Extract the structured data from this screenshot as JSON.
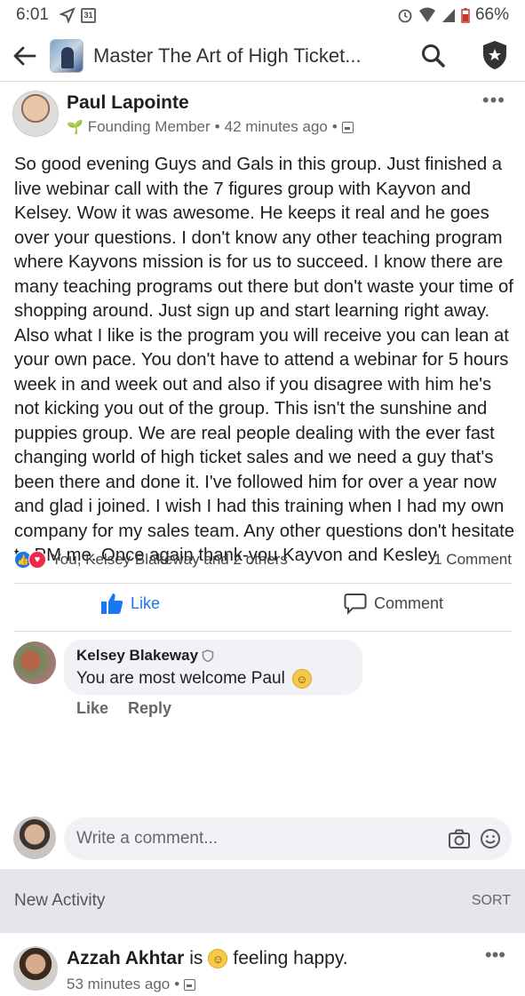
{
  "status_bar": {
    "time": "6:01",
    "battery": "66%"
  },
  "header": {
    "group_title": "Master The Art of High Ticket..."
  },
  "post": {
    "author": "Paul Lapointe",
    "badge": "Founding Member",
    "time": "42 minutes ago",
    "body": "So good evening Guys and Gals in this group. Just finished a live webinar call with the 7 figures group with Kayvon and Kelsey.  Wow it was awesome. He keeps it real and he goes over your questions.   I don't know any other teaching program where Kayvons mission is for us to succeed.  I know there are many teaching programs out there but don't waste your time of shopping around. Just sign up and start learning right away.  Also what I like is the program you will receive you can lean at your own pace. You don't have to attend a webinar for 5 hours week in and week out and also if you disagree with him he's not kicking you out of the group. This isn't the sunshine and puppies group. We are real people dealing with the ever fast changing world of high ticket sales and we need a guy that's been there and done it. I've followed him for over a year now and glad i joined.  I wish I had this training when I had my own company for my sales team.   Any other questions don't hesitate to PM me. Once again thank-you Kayvon and Kesley",
    "reactions_text": "You, Kelsey Blakeway and 2 others",
    "comment_count": "1 Comment",
    "like_label": "Like",
    "comment_label": "Comment"
  },
  "comment": {
    "author": "Kelsey Blakeway",
    "text": "You are most welcome Paul",
    "like_label": "Like",
    "reply_label": "Reply"
  },
  "composer": {
    "placeholder": "Write a comment..."
  },
  "activity": {
    "title": "New Activity",
    "sort_label": "SORT"
  },
  "post2": {
    "author": "Azzah Akhtar",
    "is_label": "is",
    "feeling": "feeling happy.",
    "time": "53 minutes ago"
  },
  "icons": {
    "back": "arrow-left",
    "search": "magnifier",
    "shield": "shield-star",
    "more": "ellipsis",
    "like": "thumbs-up",
    "comment": "speech-bubble",
    "camera": "camera",
    "emoji": "smiley"
  },
  "colors": {
    "accent": "#1877f2",
    "love": "#f0284a",
    "muted": "#65676b",
    "activity_bg": "#e4e6eb"
  }
}
